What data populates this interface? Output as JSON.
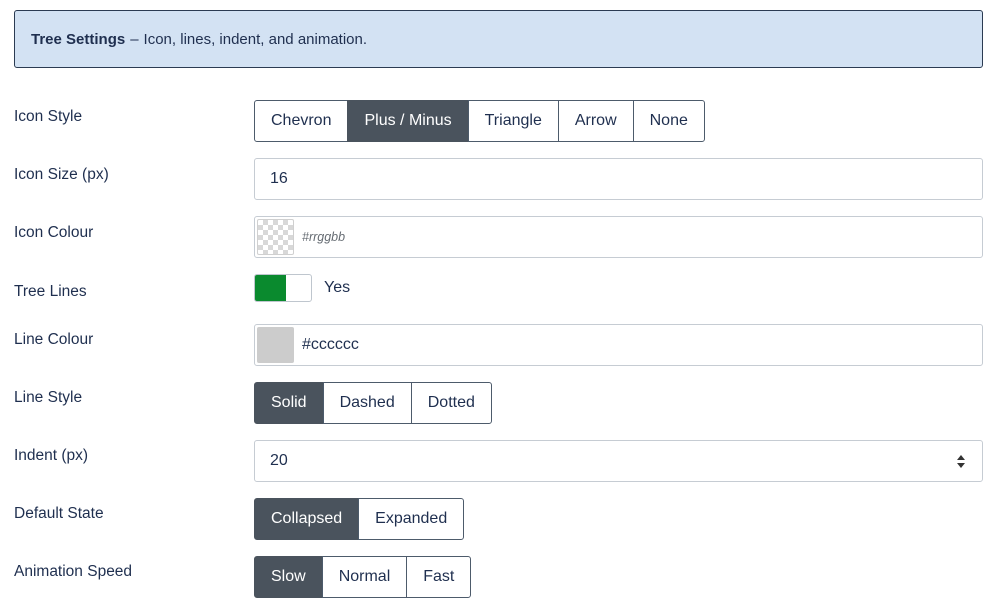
{
  "banner": {
    "title": "Tree Settings",
    "separator": "–",
    "description": "Icon, lines, indent, and animation."
  },
  "fields": {
    "icon_style": {
      "label": "Icon Style",
      "options": [
        "Chevron",
        "Plus / Minus",
        "Triangle",
        "Arrow",
        "None"
      ],
      "selected": "Plus / Minus"
    },
    "icon_size": {
      "label": "Icon Size (px)",
      "value": "16"
    },
    "icon_colour": {
      "label": "Icon Colour",
      "value": "",
      "placeholder": "#rrggbb"
    },
    "tree_lines": {
      "label": "Tree Lines",
      "state_label": "Yes",
      "on_color": "#0a8a2e"
    },
    "line_colour": {
      "label": "Line Colour",
      "value": "#cccccc",
      "swatch_color": "#cccccc"
    },
    "line_style": {
      "label": "Line Style",
      "options": [
        "Solid",
        "Dashed",
        "Dotted"
      ],
      "selected": "Solid"
    },
    "indent": {
      "label": "Indent (px)",
      "value": "20"
    },
    "default_state": {
      "label": "Default State",
      "options": [
        "Collapsed",
        "Expanded"
      ],
      "selected": "Collapsed"
    },
    "animation_speed": {
      "label": "Animation Speed",
      "options": [
        "Slow",
        "Normal",
        "Fast"
      ],
      "selected": "Slow"
    }
  },
  "colors": {
    "active_segment": "#4a535d",
    "banner_bg": "#d3e2f3",
    "text": "#1f2f4f"
  }
}
